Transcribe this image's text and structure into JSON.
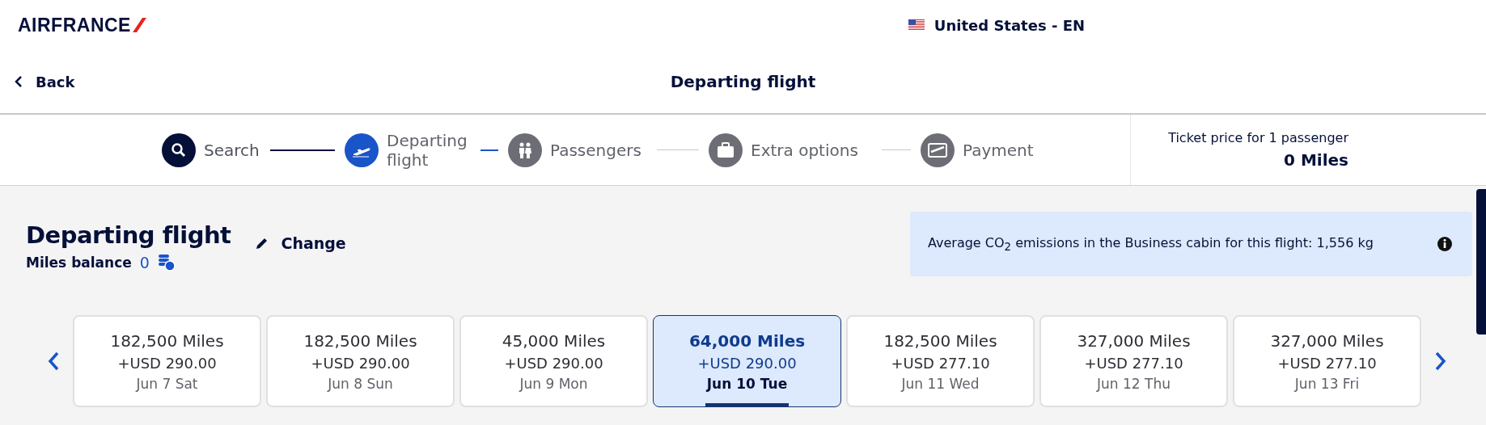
{
  "header": {
    "logo": "AIRFRANCE",
    "locale": "United States - EN",
    "back": "Back",
    "title": "Departing flight"
  },
  "steps": [
    {
      "label": "Search",
      "done": true,
      "selected": false
    },
    {
      "label": "Departing flight",
      "done": false,
      "selected": true
    },
    {
      "label": "Passengers",
      "done": false,
      "selected": false
    },
    {
      "label": "Extra options",
      "done": false,
      "selected": false
    },
    {
      "label": "Payment",
      "done": false,
      "selected": false
    }
  ],
  "ticket_price": {
    "label": "Ticket price for 1 passenger",
    "value": "0 Miles"
  },
  "section": {
    "title": "Departing flight",
    "change": "Change",
    "balance_label": "Miles balance",
    "balance_value": "0"
  },
  "emissions": {
    "text": "Average CO$_{2}$ emissions in the Business cabin for this flight: 1,556 kg"
  },
  "dates": [
    {
      "miles": "182,500 Miles",
      "price": "+USD 290.00",
      "date": "Jun 7 Sat",
      "selected": false
    },
    {
      "miles": "182,500 Miles",
      "price": "+USD 290.00",
      "date": "Jun 8 Sun",
      "selected": false
    },
    {
      "miles": "45,000 Miles",
      "price": "+USD 290.00",
      "date": "Jun 9 Mon",
      "selected": false
    },
    {
      "miles": "64,000 Miles",
      "price": "+USD 290.00",
      "date": "Jun 10 Tue",
      "selected": true
    },
    {
      "miles": "182,500 Miles",
      "price": "+USD 277.10",
      "date": "Jun 11 Wed",
      "selected": false
    },
    {
      "miles": "327,000 Miles",
      "price": "+USD 277.10",
      "date": "Jun 12 Thu",
      "selected": false
    },
    {
      "miles": "327,000 Miles",
      "price": "+USD 277.10",
      "date": "Jun 13 Fri",
      "selected": false
    }
  ]
}
